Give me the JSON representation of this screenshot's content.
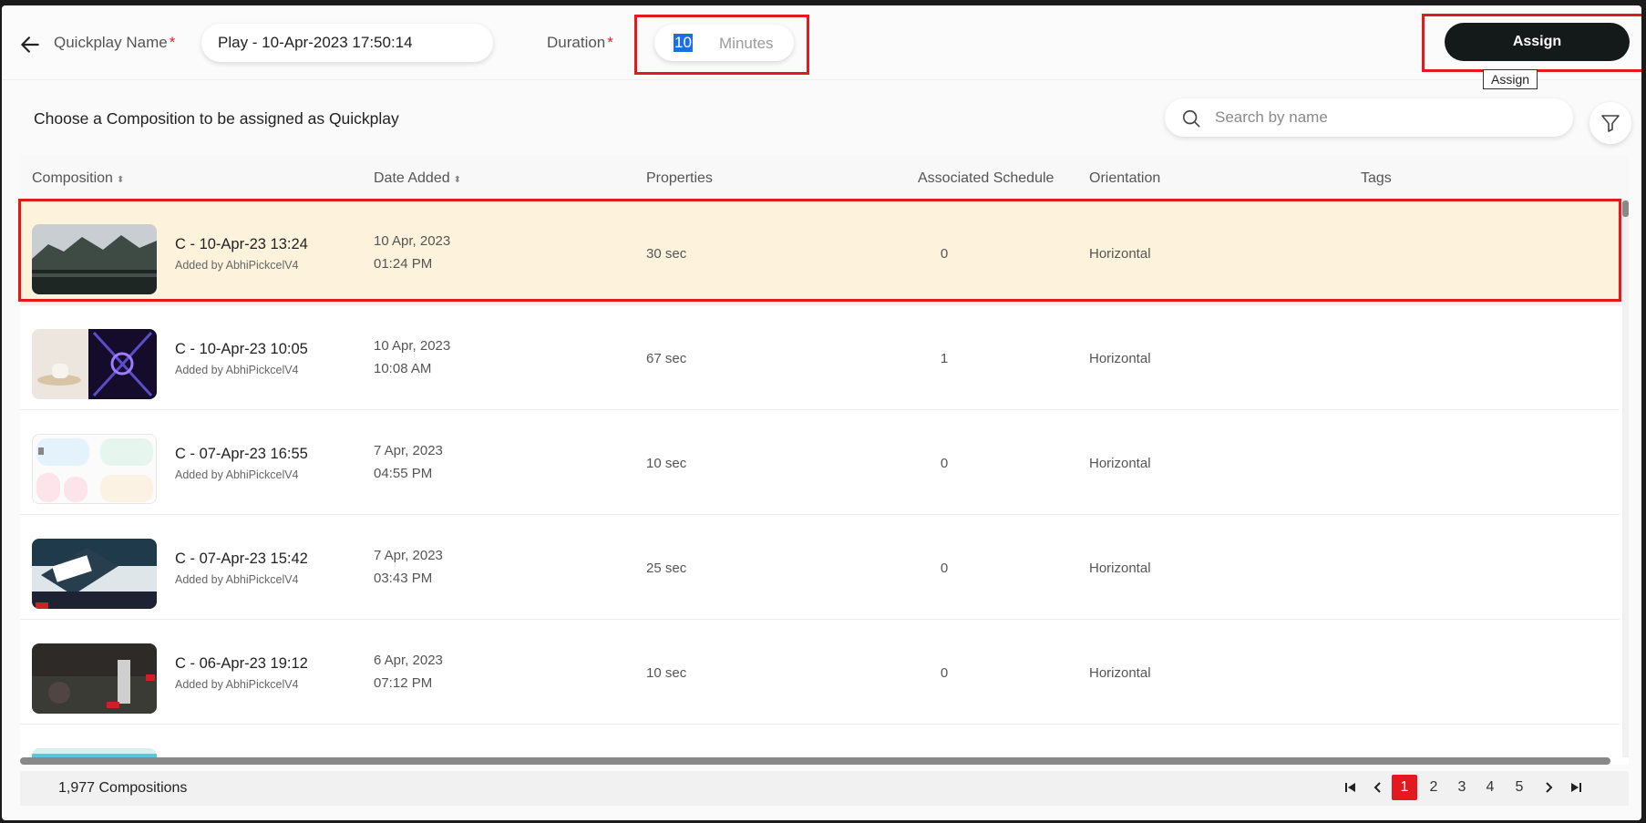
{
  "header": {
    "quickplay_label": "Quickplay Name",
    "quickplay_value": "Play - 10-Apr-2023 17:50:14",
    "duration_label": "Duration",
    "duration_value": "10",
    "duration_unit": "Minutes",
    "assign_label": "Assign",
    "assign_tooltip": "Assign"
  },
  "subheader": {
    "title": "Choose a Composition to be assigned as Quickplay",
    "search_placeholder": "Search by name"
  },
  "table": {
    "columns": [
      "Composition",
      "Date Added",
      "Properties",
      "Associated Schedule",
      "Orientation",
      "Tags"
    ],
    "rows": [
      {
        "name": "C - 10-Apr-23 13:24",
        "added_by": "Added by AbhiPickcelV4",
        "date": "10 Apr, 2023",
        "time": "01:24 PM",
        "properties": "30 sec",
        "schedule": "0",
        "orientation": "Horizontal"
      },
      {
        "name": "C - 10-Apr-23 10:05",
        "added_by": "Added by AbhiPickcelV4",
        "date": "10 Apr, 2023",
        "time": "10:08 AM",
        "properties": "67 sec",
        "schedule": "1",
        "orientation": "Horizontal"
      },
      {
        "name": "C - 07-Apr-23 16:55",
        "added_by": "Added by AbhiPickcelV4",
        "date": "7 Apr, 2023",
        "time": "04:55 PM",
        "properties": "10 sec",
        "schedule": "0",
        "orientation": "Horizontal"
      },
      {
        "name": "C - 07-Apr-23 15:42",
        "added_by": "Added by AbhiPickcelV4",
        "date": "7 Apr, 2023",
        "time": "03:43 PM",
        "properties": "25 sec",
        "schedule": "0",
        "orientation": "Horizontal"
      },
      {
        "name": "C - 06-Apr-23 19:12",
        "added_by": "Added by AbhiPickcelV4",
        "date": "6 Apr, 2023",
        "time": "07:12 PM",
        "properties": "10 sec",
        "schedule": "0",
        "orientation": "Horizontal"
      }
    ]
  },
  "footer": {
    "count": "1,977 Compositions",
    "pages": [
      "1",
      "2",
      "3",
      "4",
      "5"
    ],
    "active_page": "1"
  },
  "colors": {
    "accent": "#e3191f",
    "assign_button": "#141a1a",
    "selected_row": "#fdf3dc"
  },
  "icons": [
    "back-arrow-icon",
    "search-icon",
    "filter-icon",
    "sort-icon",
    "first-page-icon",
    "prev-page-icon",
    "next-page-icon",
    "last-page-icon"
  ]
}
